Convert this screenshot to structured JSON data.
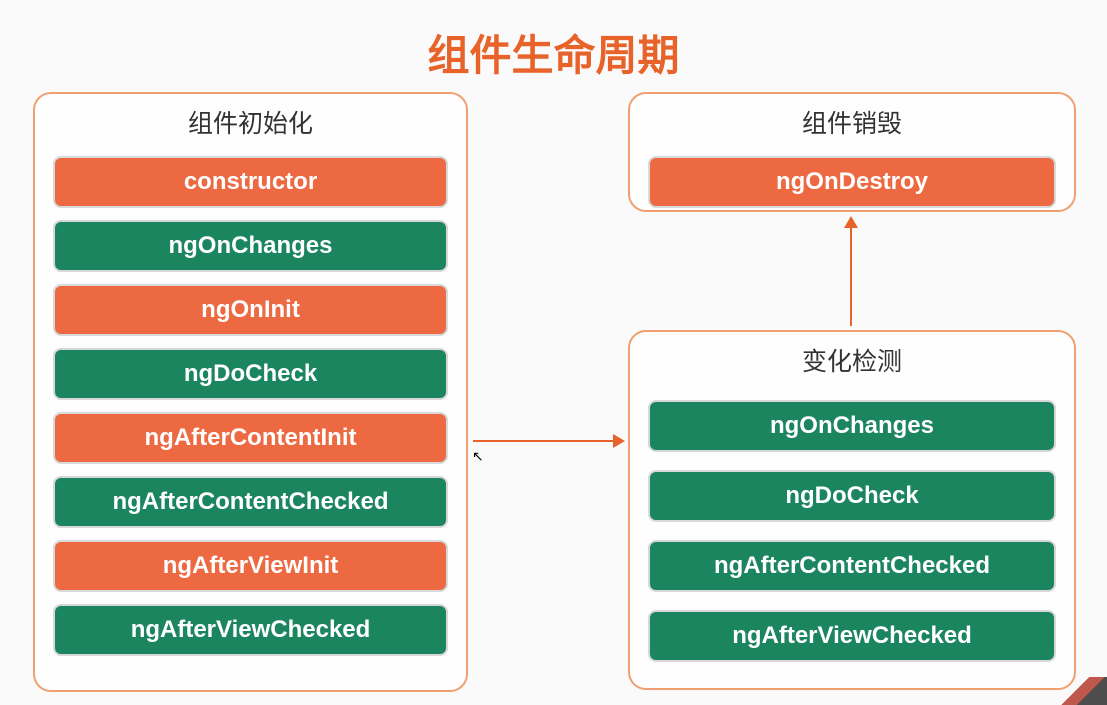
{
  "title": "组件生命周期",
  "colors": {
    "orange": "#ec6941",
    "green": "#1b8560",
    "border": "#f0a070",
    "titleColor": "#e8632a"
  },
  "boxes": {
    "init": {
      "title": "组件初始化",
      "items": [
        {
          "label": "constructor",
          "color": "orange"
        },
        {
          "label": "ngOnChanges",
          "color": "green"
        },
        {
          "label": "ngOnInit",
          "color": "orange"
        },
        {
          "label": "ngDoCheck",
          "color": "green"
        },
        {
          "label": "ngAfterContentInit",
          "color": "orange"
        },
        {
          "label": "ngAfterContentChecked",
          "color": "green"
        },
        {
          "label": "ngAfterViewInit",
          "color": "orange"
        },
        {
          "label": "ngAfterViewChecked",
          "color": "green"
        }
      ]
    },
    "destroy": {
      "title": "组件销毁",
      "items": [
        {
          "label": "ngOnDestroy",
          "color": "orange"
        }
      ]
    },
    "change": {
      "title": "变化检测",
      "items": [
        {
          "label": "ngOnChanges",
          "color": "green"
        },
        {
          "label": "ngDoCheck",
          "color": "green"
        },
        {
          "label": "ngAfterContentChecked",
          "color": "green"
        },
        {
          "label": "ngAfterViewChecked",
          "color": "green"
        }
      ]
    }
  },
  "arrows": {
    "initToChange": "right",
    "changeToDestroy": "up"
  }
}
